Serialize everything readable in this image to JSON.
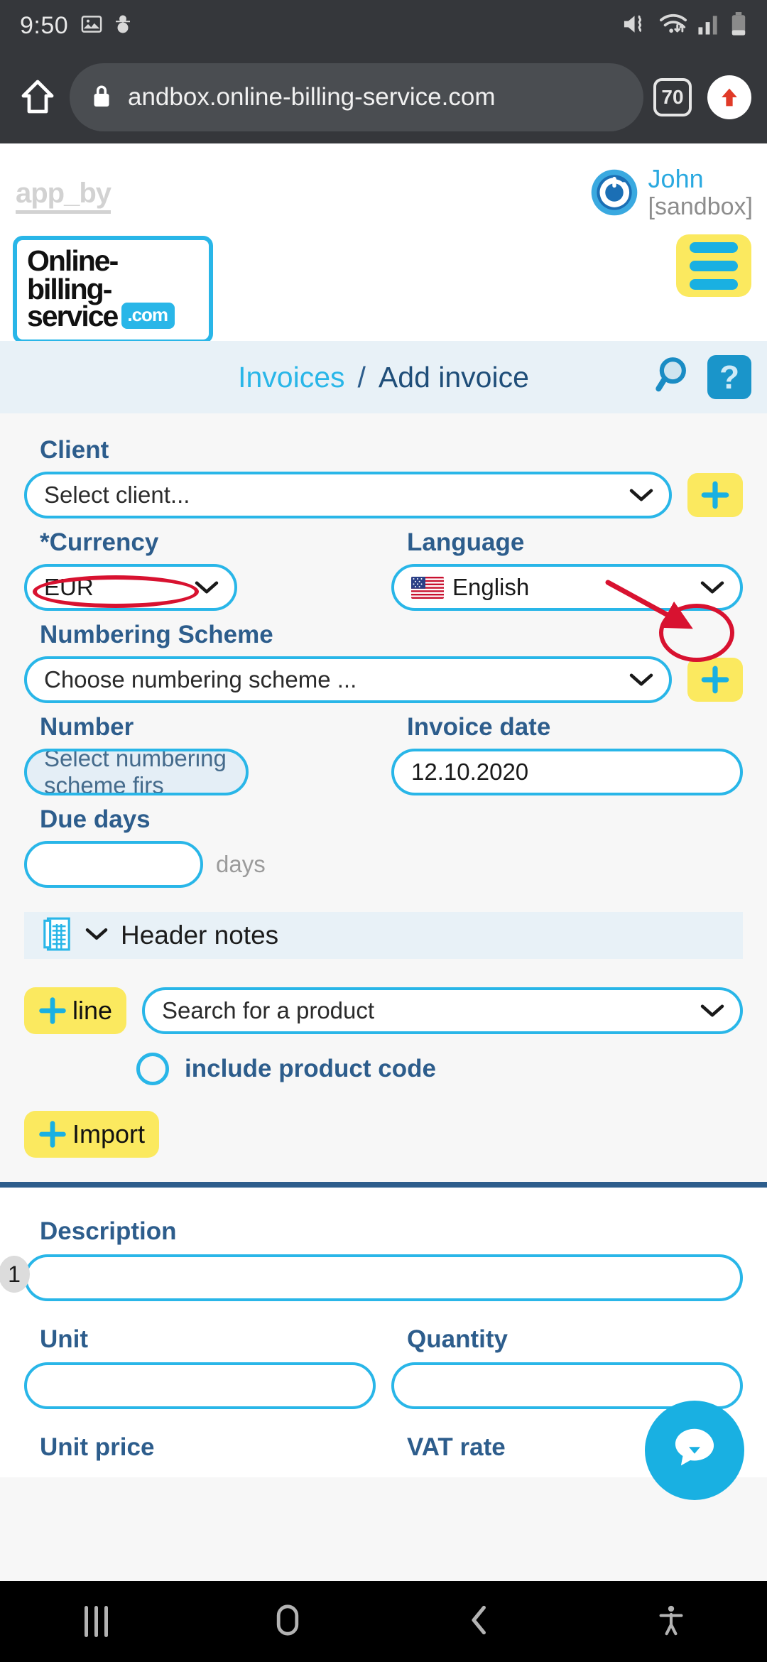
{
  "status_bar": {
    "time": "9:50",
    "left_icons": [
      "image-icon",
      "snowman-icon"
    ],
    "right_icons": [
      "mute-vibrate-icon",
      "wifi-icon",
      "cellular-signal-icon",
      "battery-icon"
    ]
  },
  "browser": {
    "home_icon": "home-icon",
    "lock_icon": "lock-icon",
    "url": "andbox.online-billing-service.com",
    "tab_count": "70",
    "upload_icon": "upload-arrow-icon"
  },
  "app_header": {
    "app_by": "app_by",
    "logo_line1": "Online-billing-",
    "logo_line2": "service",
    "logo_badge": ".com",
    "user_name": "John",
    "user_env": "[sandbox]",
    "power_icon": "power-icon",
    "menu_icon": "hamburger-menu-icon"
  },
  "breadcrumb": {
    "parent": "Invoices",
    "separator": "/",
    "current": "Add invoice",
    "search_icon": "search-icon",
    "help_label": "?"
  },
  "form": {
    "client": {
      "label": "Client",
      "placeholder": "Select client...",
      "add_icon": "plus-icon"
    },
    "currency": {
      "label": "Currency",
      "required_marker": "*",
      "value": "EUR"
    },
    "language": {
      "label": "Language",
      "value": "English",
      "flag": "us-flag-icon"
    },
    "numbering_scheme": {
      "label": "Numbering Scheme",
      "placeholder": "Choose numbering scheme ...",
      "add_icon": "plus-icon"
    },
    "number": {
      "label": "Number",
      "placeholder": "Select numbering scheme firs"
    },
    "invoice_date": {
      "label": "Invoice date",
      "value": "12.10.2020"
    },
    "due_days": {
      "label": "Due days",
      "value": "",
      "unit": "days"
    },
    "header_notes": {
      "label": "Header notes",
      "icon": "notepad-icon",
      "chevron": "chevron-down-icon"
    },
    "add_line": {
      "label": "line",
      "plus": "+"
    },
    "product_search": {
      "placeholder": "Search for a product"
    },
    "include_product_code": {
      "label": "include product code",
      "checked": false
    },
    "import": {
      "label": "Import",
      "plus": "+"
    }
  },
  "line_items": [
    {
      "index": "1",
      "description_label": "Description",
      "description_value": "",
      "unit_label": "Unit",
      "unit_value": "",
      "quantity_label": "Quantity",
      "quantity_value": "",
      "unit_price_label": "Unit price",
      "vat_rate_label": "VAT rate"
    }
  ],
  "chat_widget": {
    "icon": "chat-bubble-icon"
  },
  "annotations": {
    "highlight_color": "#d81230",
    "ellipse_numbering_scheme_label": true,
    "ellipse_add_scheme_button": true,
    "arrow_to_add_scheme_button": true
  },
  "nav_bar": {
    "recents": "recents-icon",
    "home": "home-circle-icon",
    "back": "back-chevron-icon",
    "accessibility": "accessibility-icon"
  },
  "colors": {
    "accent_cyan": "#29b6e8",
    "accent_yellow": "#fbe95f",
    "label_blue": "#2d5d8c",
    "page_bg": "#f7f7f7",
    "strip_bg": "#e8f1f7"
  }
}
